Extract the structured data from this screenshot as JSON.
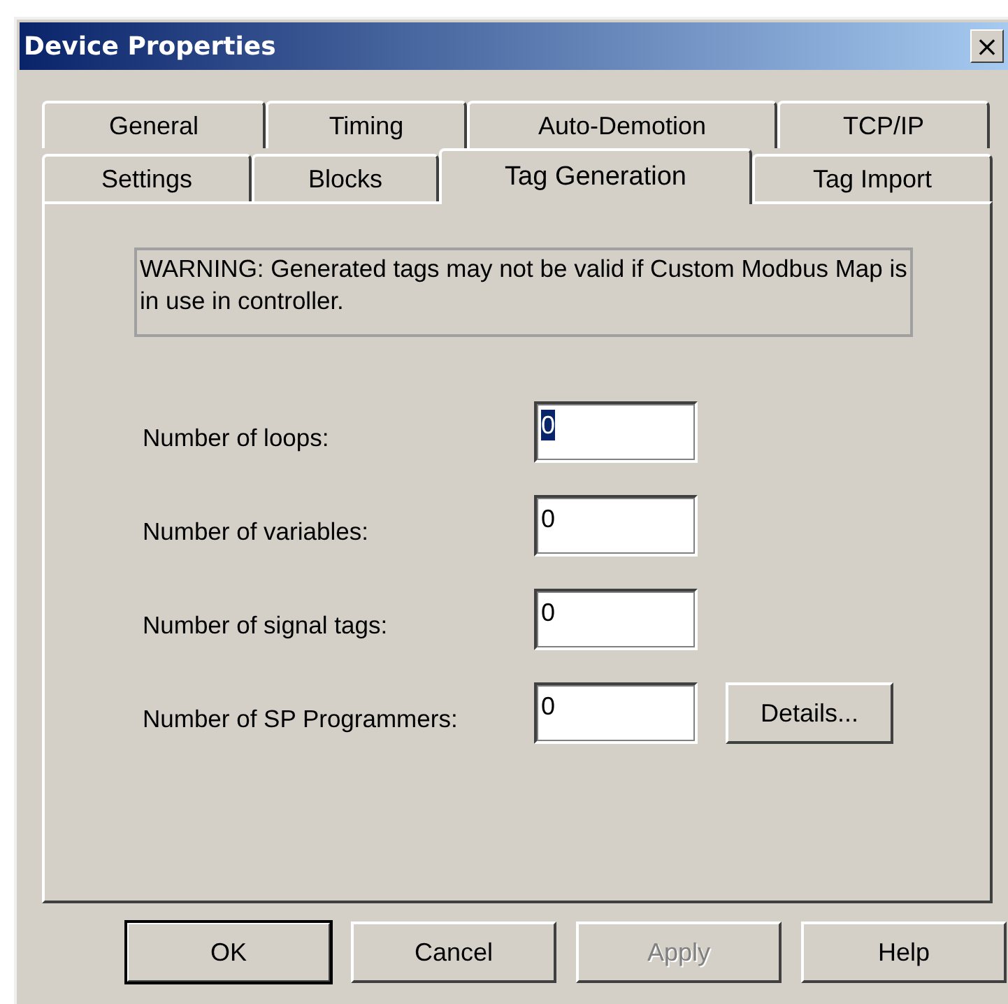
{
  "window": {
    "title": "Device Properties",
    "close": "×"
  },
  "tab_rows": [
    [
      {
        "label": "General",
        "selected": false
      },
      {
        "label": "Timing",
        "selected": false
      },
      {
        "label": "Auto-Demotion",
        "selected": false
      },
      {
        "label": "TCP/IP",
        "selected": false
      }
    ],
    [
      {
        "label": "Settings",
        "selected": false
      },
      {
        "label": "Blocks",
        "selected": false
      },
      {
        "label": "Tag Generation",
        "selected": true
      },
      {
        "label": "Tag Import",
        "selected": false
      }
    ]
  ],
  "warning": "WARNING: Generated tags may not be valid if Custom Modbus Map is in use in controller.",
  "fields": [
    {
      "label": "Number of loops:",
      "value": "0",
      "focused": true
    },
    {
      "label": "Number of variables:",
      "value": "0",
      "focused": false
    },
    {
      "label": "Number of signal tags:",
      "value": "0",
      "focused": false
    },
    {
      "label": "Number of SP Programmers:",
      "value": "0",
      "focused": false,
      "button": "Details..."
    }
  ],
  "buttons": [
    {
      "label": "OK",
      "default": true,
      "disabled": false
    },
    {
      "label": "Cancel",
      "default": false,
      "disabled": false
    },
    {
      "label": "Apply",
      "default": false,
      "disabled": true
    },
    {
      "label": "Help",
      "default": false,
      "disabled": false
    }
  ]
}
